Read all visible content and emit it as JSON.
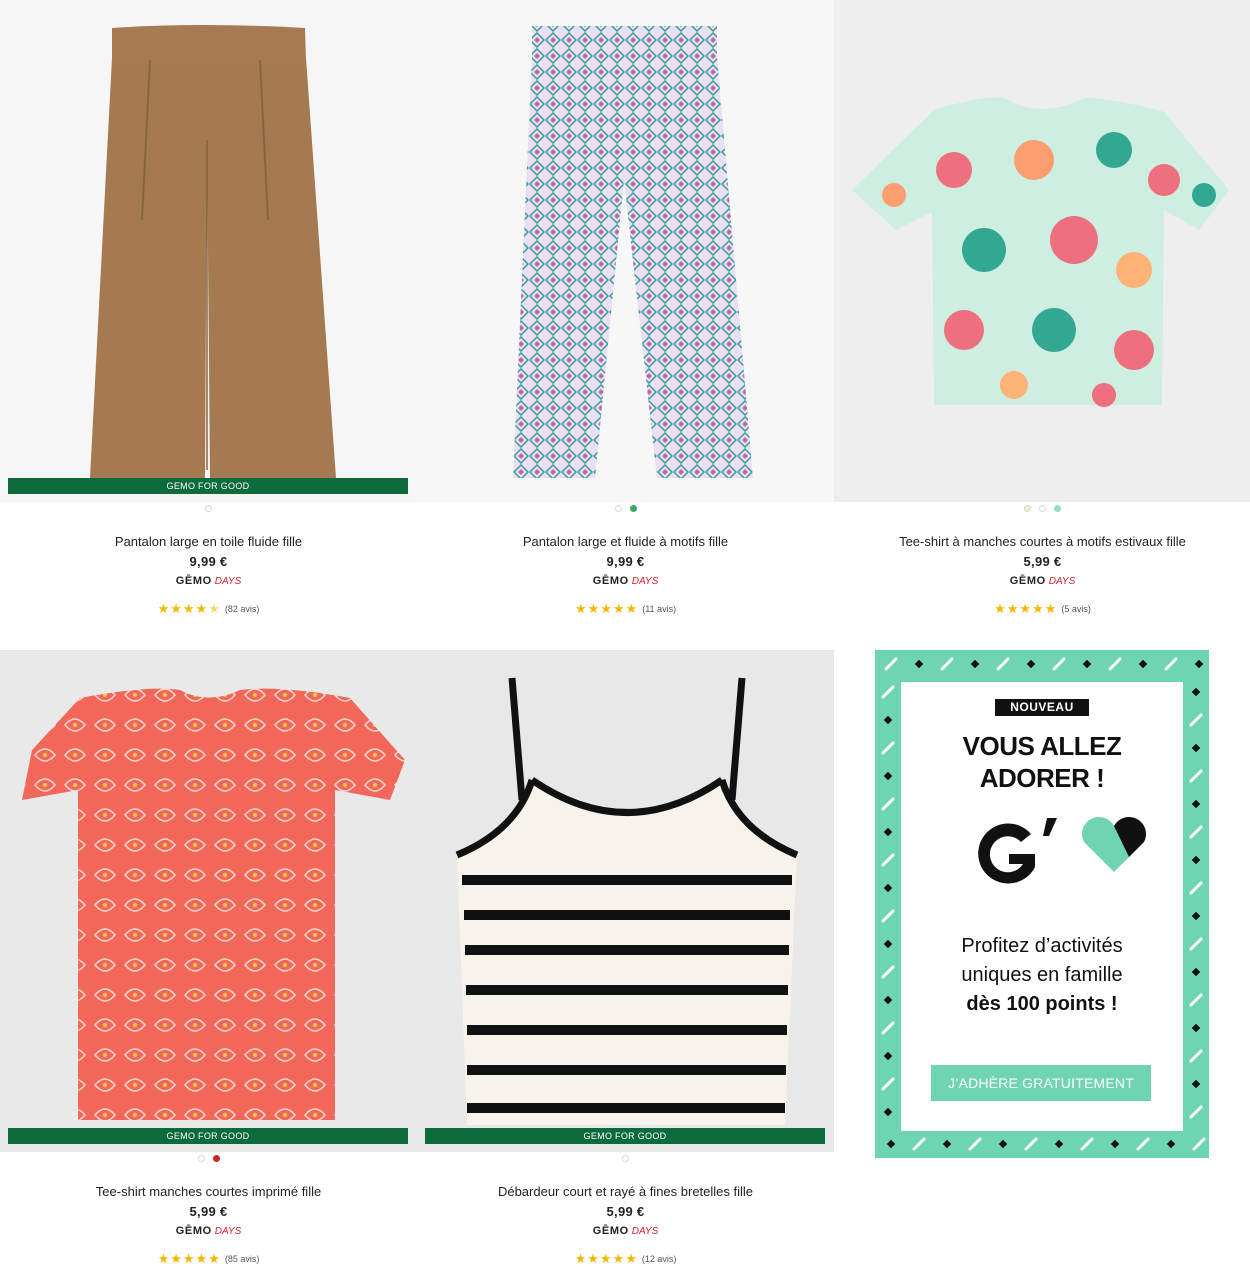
{
  "products": [
    {
      "title": "Pantalon large en toile fluide fille",
      "price": "9,99 €",
      "badge": "GEMO FOR GOOD",
      "brand_logo": "GĒMO",
      "brand_days": "DAYS",
      "stars": "★★★★",
      "stars_partial": "★",
      "reviews": "(82 avis)",
      "swatch_colors": [
        "#ffffff"
      ],
      "image_icon": "brown-wide-pants-image"
    },
    {
      "title": "Pantalon large et fluide à motifs fille",
      "price": "9,99 €",
      "badge": "",
      "brand_logo": "GĒMO",
      "brand_days": "DAYS",
      "stars": "★★★★★",
      "stars_partial": "",
      "reviews": "(11 avis)",
      "swatch_colors": [
        "#ffffff",
        "#3aa86a"
      ],
      "image_icon": "patterned-pants-image"
    },
    {
      "title": "Tee-shirt à manches courtes à motifs estivaux fille",
      "price": "5,99 €",
      "badge": "",
      "brand_logo": "GĒMO",
      "brand_days": "DAYS",
      "stars": "★★★★★",
      "stars_partial": "",
      "reviews": "(5 avis)",
      "swatch_colors": [
        "#f4f1c2",
        "#ffffff",
        "#8fe0c0"
      ],
      "image_icon": "floral-tshirt-image"
    },
    {
      "title": "Tee-shirt manches courtes imprimé fille",
      "price": "5,99 €",
      "badge": "GEMO FOR GOOD",
      "brand_logo": "GĒMO",
      "brand_days": "DAYS",
      "stars": "★★★★★",
      "stars_partial": "",
      "reviews": "(85 avis)",
      "swatch_colors": [
        "#ffffff",
        "#d2232a"
      ],
      "image_icon": "coral-printed-tshirt-image"
    },
    {
      "title": "Débardeur court et rayé à fines bretelles fille",
      "price": "5,99 €",
      "badge": "GEMO FOR GOOD",
      "brand_logo": "GĒMO",
      "brand_days": "DAYS",
      "stars": "★★★★★",
      "stars_partial": "",
      "reviews": "(12 avis)",
      "swatch_colors": [
        "#ffffff"
      ],
      "image_icon": "striped-tank-top-image"
    }
  ],
  "promo": {
    "tag": "NOUVEAU",
    "headline_1": "VOUS ALLEZ",
    "headline_2": "ADORER !",
    "body_1": "Profitez d’activités",
    "body_2": "uniques en famille",
    "body_3": "dès 100 points !",
    "cta": "J’ADHÈRE GRATUITEMENT",
    "accent": "#6fd4b2"
  },
  "colors": {
    "badge_green": "#0b6b3c",
    "days_red": "#d2232a",
    "star_yellow": "#f5b800"
  }
}
